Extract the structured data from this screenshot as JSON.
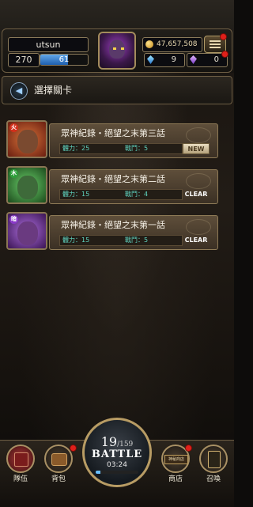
{
  "header": {
    "player_name": "utsun",
    "level": "270",
    "exp_display": "61",
    "exp_fraction": 0.58,
    "gold": "47,657,508",
    "gem_blue": "9",
    "gem_purple": "0"
  },
  "stage": {
    "title": "選擇關卡"
  },
  "quests": [
    {
      "title": "眾神紀錄・絕望之末第三話",
      "stamina": "體力：25",
      "battles": "戰鬥：5",
      "badge": "NEW"
    },
    {
      "title": "眾神紀錄・絕望之末第二話",
      "stamina": "體力：15",
      "battles": "戰鬥：4",
      "badge": "CLEAR"
    },
    {
      "title": "眾神紀錄・絕望之末第一話",
      "stamina": "體力：15",
      "battles": "戰鬥：5",
      "badge": "CLEAR"
    }
  ],
  "battle": {
    "current": "19",
    "max": "/159",
    "label": "BATTLE",
    "timer": "03:24",
    "fraction": 0.12
  },
  "nav": {
    "team": "隊伍",
    "bag": "背包",
    "shop": "商店",
    "summon": "召喚",
    "shop_sign": "神秘商店"
  },
  "colors": {
    "accent_gold": "#b89c64",
    "stat_cyan": "#5fd4c0",
    "notify_red": "#e0201a"
  }
}
